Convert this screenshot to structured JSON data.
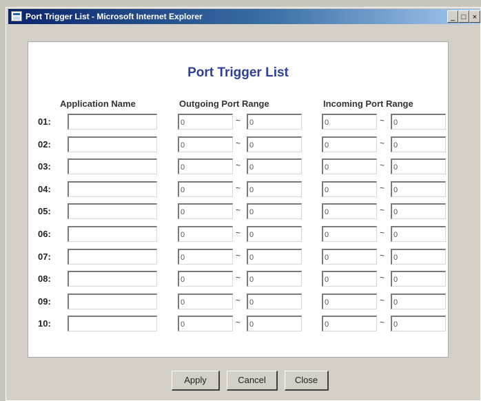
{
  "window": {
    "title": "Port Trigger List - Microsoft Internet Explorer",
    "controls": {
      "minimize": "_",
      "maximize": "□",
      "close": "×"
    }
  },
  "form": {
    "heading": "Port Trigger List",
    "columns": {
      "application": "Application Name",
      "outgoing": "Outgoing Port Range",
      "incoming": "Incoming Port Range"
    },
    "separator": "~",
    "rows": [
      {
        "label": "01:",
        "app_name": "",
        "out_start": "0",
        "out_end": "0",
        "in_start": "0",
        "in_end": "0"
      },
      {
        "label": "02:",
        "app_name": "",
        "out_start": "0",
        "out_end": "0",
        "in_start": "0",
        "in_end": "0"
      },
      {
        "label": "03:",
        "app_name": "",
        "out_start": "0",
        "out_end": "0",
        "in_start": "0",
        "in_end": "0"
      },
      {
        "label": "04:",
        "app_name": "",
        "out_start": "0",
        "out_end": "0",
        "in_start": "0",
        "in_end": "0"
      },
      {
        "label": "05:",
        "app_name": "",
        "out_start": "0",
        "out_end": "0",
        "in_start": "0",
        "in_end": "0"
      },
      {
        "label": "06:",
        "app_name": "",
        "out_start": "0",
        "out_end": "0",
        "in_start": "0",
        "in_end": "0"
      },
      {
        "label": "07:",
        "app_name": "",
        "out_start": "0",
        "out_end": "0",
        "in_start": "0",
        "in_end": "0"
      },
      {
        "label": "08:",
        "app_name": "",
        "out_start": "0",
        "out_end": "0",
        "in_start": "0",
        "in_end": "0"
      },
      {
        "label": "09:",
        "app_name": "",
        "out_start": "0",
        "out_end": "0",
        "in_start": "0",
        "in_end": "0"
      },
      {
        "label": "10:",
        "app_name": "",
        "out_start": "0",
        "out_end": "0",
        "in_start": "0",
        "in_end": "0"
      }
    ],
    "buttons": {
      "apply": "Apply",
      "cancel": "Cancel",
      "close": "Close"
    }
  },
  "colors": {
    "heading": "#2e3f9a",
    "titlebar": "#0a246a"
  },
  "icons": {
    "title": "ie-page-icon"
  }
}
